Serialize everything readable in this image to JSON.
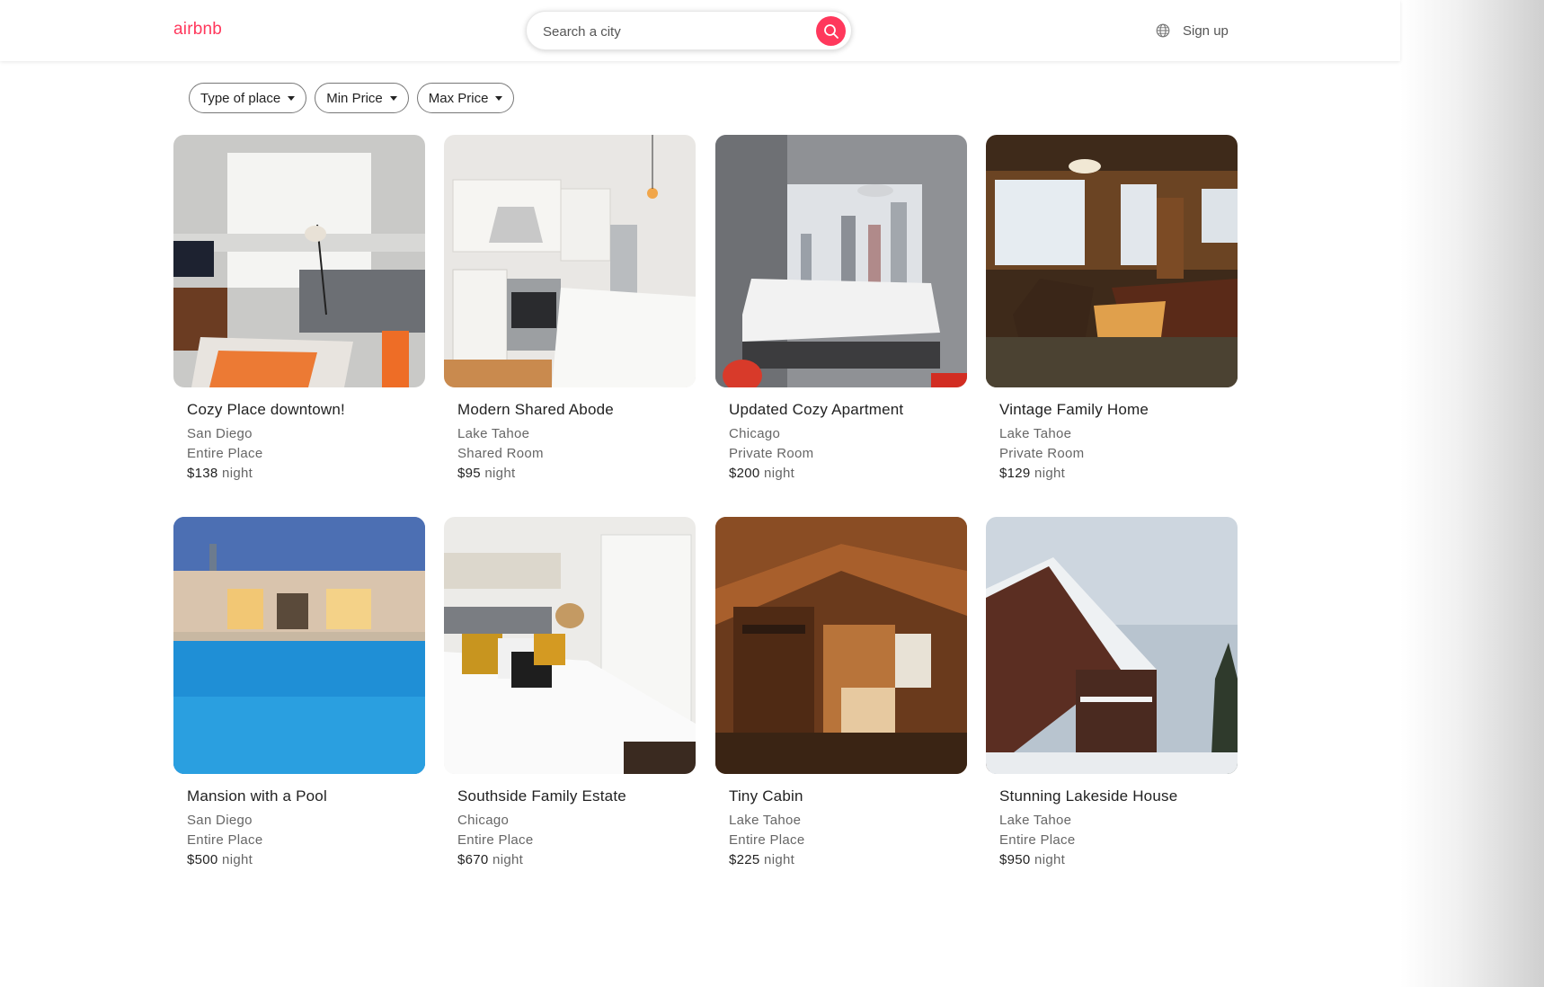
{
  "header": {
    "logo": "airbnb",
    "search_placeholder": "Search a city",
    "signup_label": "Sign up"
  },
  "filters": [
    {
      "label": "Type of place"
    },
    {
      "label": "Min Price"
    },
    {
      "label": "Max Price"
    }
  ],
  "listings": [
    {
      "title": "Cozy Place downtown!",
      "city": "San Diego",
      "type": "Entire Place",
      "price": "$138",
      "unit": "night"
    },
    {
      "title": "Modern Shared Abode",
      "city": "Lake Tahoe",
      "type": "Shared Room",
      "price": "$95",
      "unit": "night"
    },
    {
      "title": "Updated Cozy Apartment",
      "city": "Chicago",
      "type": "Private Room",
      "price": "$200",
      "unit": "night"
    },
    {
      "title": "Vintage Family Home",
      "city": "Lake Tahoe",
      "type": "Private Room",
      "price": "$129",
      "unit": "night"
    },
    {
      "title": "Mansion with a Pool",
      "city": "San Diego",
      "type": "Entire Place",
      "price": "$500",
      "unit": "night"
    },
    {
      "title": "Southside Family Estate",
      "city": "Chicago",
      "type": "Entire Place",
      "price": "$670",
      "unit": "night"
    },
    {
      "title": "Tiny Cabin",
      "city": "Lake Tahoe",
      "type": "Entire Place",
      "price": "$225",
      "unit": "night"
    },
    {
      "title": "Stunning Lakeside House",
      "city": "Lake Tahoe",
      "type": "Entire Place",
      "price": "$950",
      "unit": "night"
    }
  ],
  "colors": {
    "brand": "#ff385c"
  },
  "icons": {
    "search": "search-icon",
    "language": "globe-icon",
    "dropdown": "caret-down-icon"
  }
}
